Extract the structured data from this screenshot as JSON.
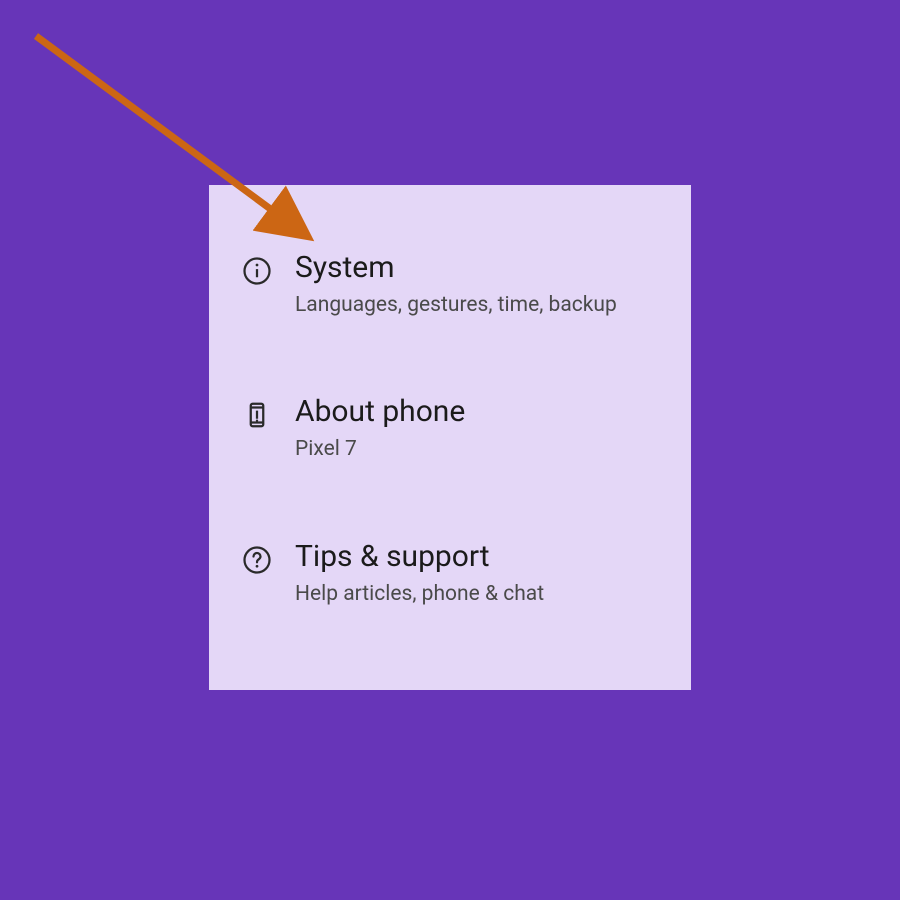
{
  "settings": {
    "items": [
      {
        "title": "System",
        "subtitle": "Languages, gestures, time, backup"
      },
      {
        "title": "About phone",
        "subtitle": "Pixel 7"
      },
      {
        "title": "Tips & support",
        "subtitle": "Help articles, phone & chat"
      }
    ]
  },
  "annotation": {
    "arrow_color": "#cc6614"
  }
}
